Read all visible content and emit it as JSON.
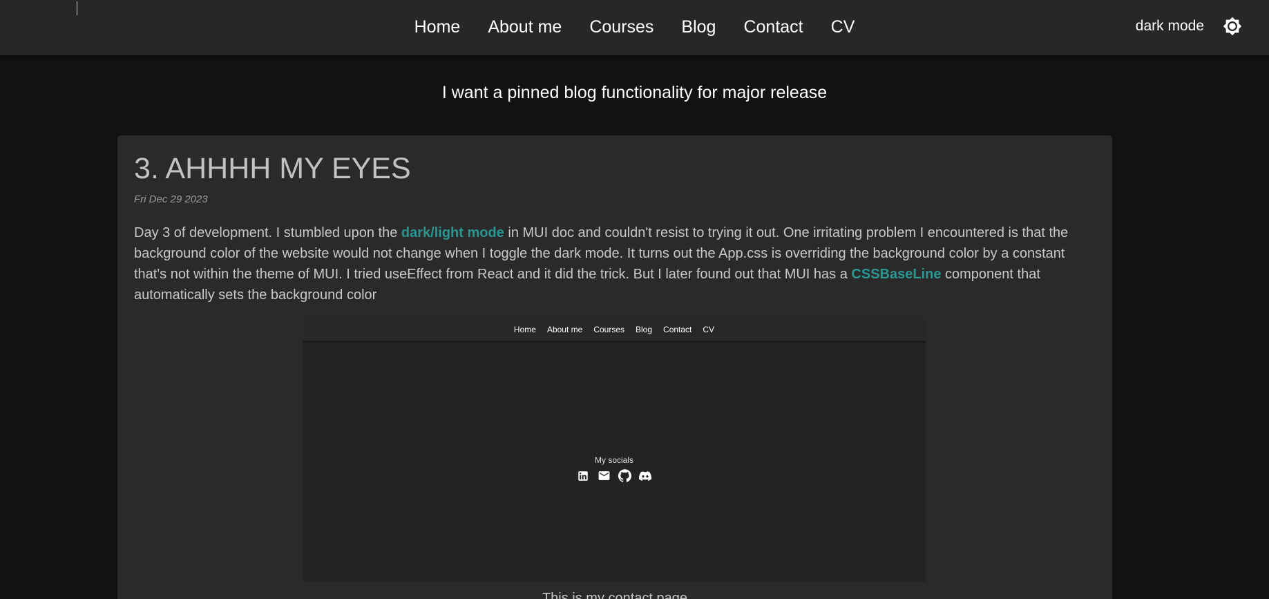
{
  "nav": {
    "items": [
      "Home",
      "About me",
      "Courses",
      "Blog",
      "Contact",
      "CV"
    ]
  },
  "mode": {
    "label": "dark mode",
    "icon": "brightness-icon"
  },
  "announcement": "I want a pinned blog functionality for major release",
  "post": {
    "title": "3. AHHHH MY EYES",
    "date": "Fri Dec 29 2023",
    "body_part1": "Day 3 of development. I stumbled upon the ",
    "link1": "dark/light mode",
    "body_part2": " in MUI doc and couldn't resist to trying it out. One irritating problem I encountered is that the background color of the website would not change when I toggle the dark mode. It turns out the App.css is overriding the background color by a constant that's not within the theme of MUI. I tried useEffect from React and it did the trick. But I later found out that MUI has a ",
    "link2": "CSSBaseLine",
    "body_part3": " component that automatically sets the background color",
    "screenshot": {
      "nav_items": [
        "Home",
        "About me",
        "Courses",
        "Blog",
        "Contact",
        "CV"
      ],
      "socials_title": "My socials",
      "icons": [
        "linkedin-icon",
        "email-icon",
        "github-icon",
        "discord-icon"
      ]
    },
    "caption": "This is my contact page"
  },
  "colors": {
    "background": "#121212",
    "appbar": "#272727",
    "card": "#2a2a2a",
    "link": "#2a9692"
  }
}
